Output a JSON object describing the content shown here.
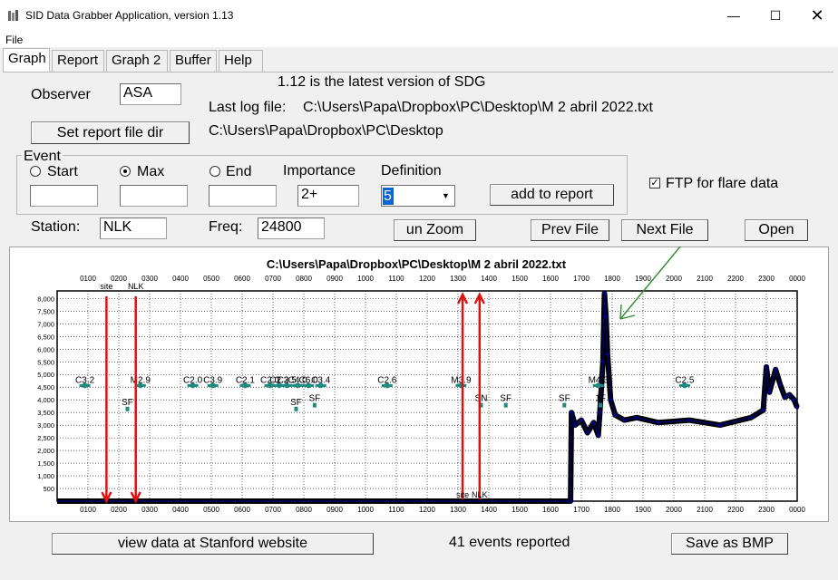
{
  "window": {
    "title": "SID Data Grabber Application, version 1.13"
  },
  "menu": {
    "file": "File"
  },
  "tabs": [
    {
      "label": "Graph",
      "active": true
    },
    {
      "label": "Report",
      "active": false
    },
    {
      "label": "Graph 2",
      "active": false
    },
    {
      "label": "Buffer",
      "active": false
    },
    {
      "label": "Help",
      "active": false
    }
  ],
  "form": {
    "observer_label": "Observer",
    "observer_value": "ASA",
    "version_note": "1.12 is the latest version of SDG",
    "last_log_label": "Last log file:",
    "last_log_value": "C:\\Users\\Papa\\Dropbox\\PC\\Desktop\\M 2 abril 2022.txt",
    "set_report_dir_button": "Set report file dir",
    "report_dir_value": "C:\\Users\\Papa\\Dropbox\\PC\\Desktop",
    "event_group_title": "Event",
    "start_label": "Start",
    "max_label": "Max",
    "end_label": "End",
    "start_value": "",
    "max_value": "",
    "end_value": "",
    "importance_label": "Importance",
    "importance_value": "2+",
    "definition_label": "Definition",
    "definition_value": "5",
    "add_to_report_button": "add to report",
    "ftp_label": "FTP for flare data",
    "ftp_checked": true,
    "station_label": "Station:",
    "station_value": "NLK",
    "freq_label": "Freq:",
    "freq_value": "24800",
    "unzoom_button": "un Zoom",
    "prev_file_button": "Prev File",
    "next_file_button": "Next File",
    "open_button": "Open",
    "stanford_button": "view data at Stanford website",
    "events_status": "41 events reported",
    "save_bmp_button": "Save as BMP"
  },
  "colors": {
    "marker_red": "#e01010",
    "event_teal": "#1f8a80",
    "signal_navy": "#000080",
    "annotation_green": "#2e8b2e"
  },
  "chart_data": {
    "type": "line",
    "title": "C:\\Users\\Papa\\Dropbox\\PC\\Desktop\\M 2 abril 2022.txt",
    "x_ticks": [
      "0100",
      "0200",
      "0300",
      "0400",
      "0500",
      "0600",
      "0700",
      "0800",
      "0900",
      "1000",
      "1100",
      "1200",
      "1300",
      "1400",
      "1500",
      "1600",
      "1700",
      "1800",
      "1900",
      "2000",
      "2100",
      "2200",
      "2300",
      "0000"
    ],
    "y_ticks": [
      "500",
      "1,000",
      "1,500",
      "2,000",
      "2,500",
      "3,000",
      "3,500",
      "4,000",
      "4,500",
      "5,000",
      "5,500",
      "6,000",
      "6,500",
      "7,000",
      "7,500",
      "8,000"
    ],
    "xlim": [
      0,
      2400
    ],
    "ylim": [
      0,
      8300
    ],
    "grid": true,
    "signal": {
      "x": [
        0,
        800,
        1500,
        1665,
        1668,
        1680,
        1700,
        1720,
        1740,
        1755,
        1760,
        1770,
        1775,
        1780,
        1785,
        1795,
        1810,
        1840,
        1880,
        1950,
        2050,
        2150,
        2250,
        2290,
        2300,
        2310,
        2330,
        2345,
        2360,
        2375,
        2390,
        2400
      ],
      "y": [
        0,
        0,
        0,
        0,
        3500,
        3000,
        3200,
        2700,
        3100,
        2600,
        3500,
        5500,
        8200,
        7300,
        5800,
        4000,
        3400,
        3200,
        3300,
        3100,
        3200,
        3000,
        3300,
        3600,
        5300,
        4300,
        5200,
        4600,
        4100,
        4200,
        4000,
        3700
      ]
    },
    "markers": [
      {
        "x": 160,
        "label": "site"
      },
      {
        "x": 255,
        "label": "NLK"
      },
      {
        "x": 1315,
        "label": "site"
      },
      {
        "x": 1370,
        "label": "NLK"
      }
    ],
    "flare_events": [
      {
        "label": "C3.2",
        "x": 90,
        "y": 4600
      },
      {
        "label": "M2.9",
        "x": 270,
        "y": 4600
      },
      {
        "label": "C2.0",
        "x": 440,
        "y": 4600
      },
      {
        "label": "C3.9",
        "x": 505,
        "y": 4600
      },
      {
        "label": "C2.1",
        "x": 610,
        "y": 4600
      },
      {
        "label": "C2.0",
        "x": 690,
        "y": 4600
      },
      {
        "label": "C2.3",
        "x": 720,
        "y": 4600
      },
      {
        "label": "C2.5",
        "x": 745,
        "y": 4600
      },
      {
        "label": "C4.0",
        "x": 780,
        "y": 4600
      },
      {
        "label": "C6.0",
        "x": 815,
        "y": 4600
      },
      {
        "label": "C3.4",
        "x": 855,
        "y": 4600
      },
      {
        "label": "C2.6",
        "x": 1070,
        "y": 4600
      },
      {
        "label": "M3.9",
        "x": 1310,
        "y": 4600
      },
      {
        "label": "M4.3",
        "x": 1755,
        "y": 4600
      },
      {
        "label": "C2.5",
        "x": 2035,
        "y": 4600
      }
    ],
    "sf_events": [
      {
        "label": "SF",
        "x": 228,
        "y": 3800
      },
      {
        "label": "SF",
        "x": 775,
        "y": 3800
      },
      {
        "label": "SF",
        "x": 835,
        "y": 3950
      },
      {
        "label": "SN",
        "x": 1375,
        "y": 3950
      },
      {
        "label": "SF",
        "x": 1455,
        "y": 3950
      },
      {
        "label": "SF",
        "x": 1645,
        "y": 3950
      },
      {
        "label": "1F",
        "x": 1762,
        "y": 3950
      }
    ]
  }
}
